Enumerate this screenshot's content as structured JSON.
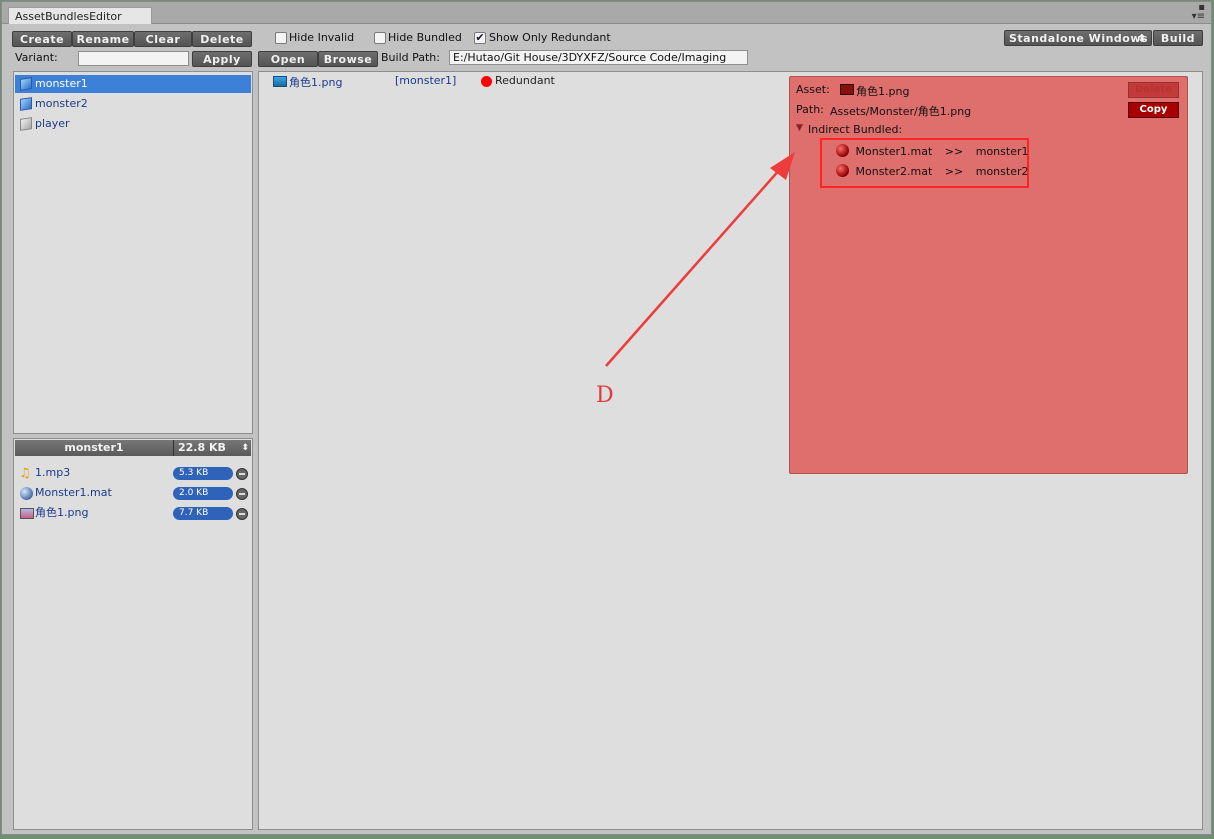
{
  "window": {
    "tab_title": "AssetBundlesEditor"
  },
  "toolbar_left": {
    "create": "Create",
    "rename": "Rename",
    "clear": "Clear",
    "delete": "Delete",
    "variant_label": "Variant:",
    "variant_value": "",
    "apply": "Apply"
  },
  "toolbar_right": {
    "hide_invalid": "Hide Invalid",
    "hide_bundled": "Hide Bundled",
    "show_only_redundant": "Show Only Redundant",
    "hide_invalid_checked": false,
    "hide_bundled_checked": false,
    "show_only_redundant_checked": true,
    "open": "Open",
    "browse": "Browse",
    "build_path_label": "Build Path:",
    "build_path_value": "E:/Hutao/Git House/3DYXFZ/Source Code/Imaging",
    "platform": "Standalone Windows",
    "build": "Build"
  },
  "bundle_list": [
    {
      "name": "monster1",
      "selected": true,
      "icon": "blue-cube-icon"
    },
    {
      "name": "monster2",
      "selected": false,
      "icon": "blue-cube-icon"
    },
    {
      "name": "player",
      "selected": false,
      "icon": "grey-cube-icon"
    }
  ],
  "bundle_detail": {
    "name": "monster1",
    "size": "22.8 KB",
    "assets": [
      {
        "name": "1.mp3",
        "size": "5.3 KB",
        "icon": "audio-icon"
      },
      {
        "name": "Monster1.mat",
        "size": "2.0 KB",
        "icon": "material-icon"
      },
      {
        "name": "角色1.png",
        "size": "7.7 KB",
        "icon": "texture-icon"
      }
    ]
  },
  "asset_row": {
    "name": "角色1.png",
    "bundle": "[monster1]",
    "status": "Redundant",
    "status_color": "#ff0000"
  },
  "asset_panel": {
    "asset_label": "Asset:",
    "asset_name": "角色1.png",
    "path_label": "Path:",
    "path_value": "Assets/Monster/角色1.png",
    "btn_top": "Delete",
    "btn_copy": "Copy",
    "indirect_label": "Indirect Bundled:",
    "dependencies": [
      {
        "material": "Monster1.mat",
        "arrow": ">>",
        "bundle": "monster1"
      },
      {
        "material": "Monster2.mat",
        "arrow": ">>",
        "bundle": "monster2"
      }
    ]
  },
  "annotation": {
    "letter": "D",
    "color": "#e03a3a"
  }
}
